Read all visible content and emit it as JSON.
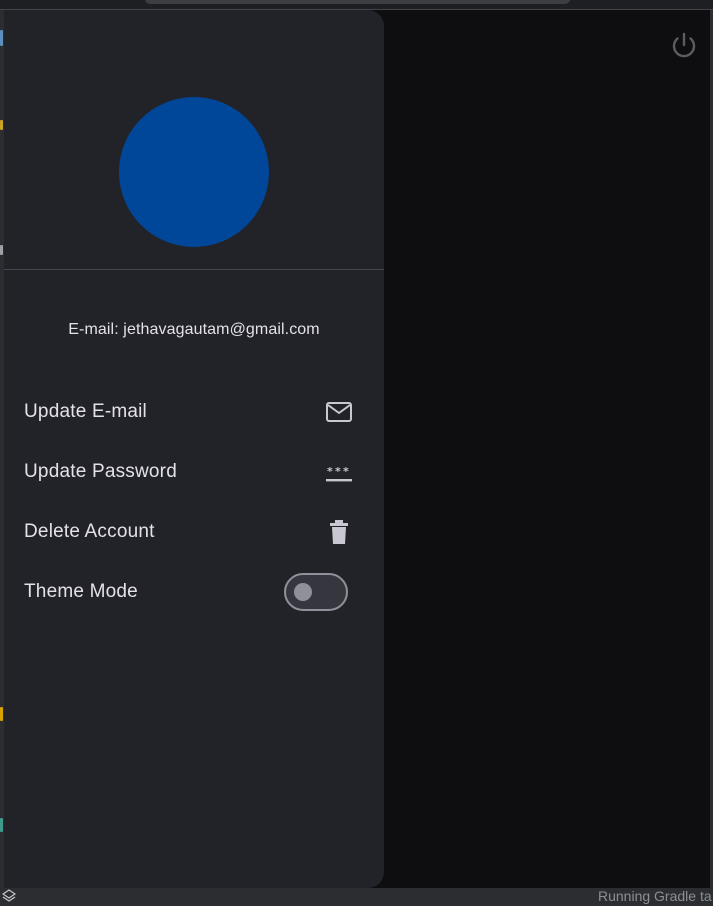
{
  "drawer": {
    "avatar_color": "#00479a",
    "email_label": "E-mail: jethavagautam@gmail.com",
    "menu": [
      {
        "label": "Update E-mail",
        "icon": "mail-icon"
      },
      {
        "label": "Update Password",
        "icon": "password-icon"
      },
      {
        "label": "Delete Account",
        "icon": "trash-icon"
      },
      {
        "label": "Theme Mode",
        "icon": "toggle-switch",
        "toggle_on": false
      }
    ]
  },
  "header": {
    "logout_icon": "power-icon"
  },
  "ide": {
    "status_text": "Running Gradle ta"
  },
  "colors": {
    "drawer_bg": "#222329",
    "screen_bg": "#0e0e10",
    "avatar": "#00479a",
    "text": "#e4e1e9"
  }
}
